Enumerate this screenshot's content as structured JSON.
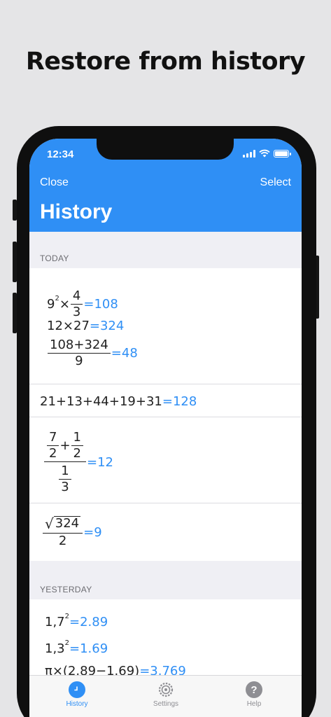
{
  "headline": "Restore from history",
  "status": {
    "time": "12:34"
  },
  "nav": {
    "close": "Close",
    "select": "Select",
    "title": "History"
  },
  "sections": {
    "today": "TODAY",
    "yesterday": "YESTERDAY"
  },
  "entries": {
    "e1": {
      "base": "9",
      "exp": "2",
      "op": "×",
      "num": "4",
      "den": "3",
      "result": "=108"
    },
    "e2": {
      "expr": "12×27",
      "result": "=324"
    },
    "e3": {
      "num": "108+324",
      "den": "9",
      "result": "=48"
    },
    "e4": {
      "expr": "21+13+44+19+31",
      "result": "=128"
    },
    "e5": {
      "n1": "7",
      "d1": "2",
      "plus": "+",
      "n2": "1",
      "d2": "2",
      "n3": "1",
      "d3": "3",
      "result": "=12"
    },
    "e6": {
      "radicand": "324",
      "den": "2",
      "result": "=9"
    },
    "e7": {
      "base": "1,7",
      "exp": "2",
      "result": "=2.89"
    },
    "e8": {
      "base": "1,3",
      "exp": "2",
      "result": "=1.69"
    },
    "e9": {
      "expr": "π×(2.89−1.69)",
      "result": "=3.769"
    }
  },
  "tabs": [
    {
      "label": "History",
      "icon": "clock-icon",
      "active": true
    },
    {
      "label": "Settings",
      "icon": "gear-icon",
      "active": false
    },
    {
      "label": "Help",
      "icon": "question-icon",
      "active": false
    }
  ],
  "colors": {
    "accent": "#2f8ff5",
    "background": "#efeff4",
    "text": "#222222"
  }
}
